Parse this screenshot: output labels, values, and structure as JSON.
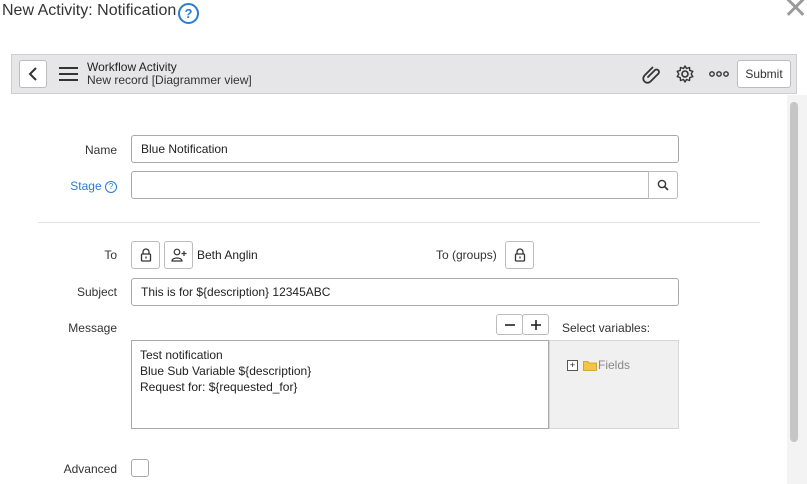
{
  "dialog": {
    "title": "New Activity: Notification",
    "help_glyph": "?",
    "close_glyph": "✕"
  },
  "header": {
    "title": "Workflow Activity",
    "subtitle": "New record [Diagrammer view]",
    "submit_label": "Submit",
    "icons": [
      "back-icon",
      "hamburger-menu-icon",
      "paperclip-icon",
      "gear-icon",
      "more-options-icon"
    ]
  },
  "form": {
    "name": {
      "label": "Name",
      "value": "Blue Notification"
    },
    "stage": {
      "label": "Stage",
      "value": "",
      "label_color": "#2a7bd4"
    },
    "to": {
      "label": "To",
      "value": "Beth Anglin"
    },
    "to_groups": {
      "label": "To (groups)"
    },
    "subject": {
      "label": "Subject",
      "value": "This is for ${description} 12345ABC"
    },
    "message": {
      "label": "Message",
      "lines": [
        "Test notification",
        "Blue Sub Variable ${description}",
        "Request for: ${requested_for}"
      ]
    },
    "select_variables": {
      "label": "Select variables:",
      "tree_item": "Fields"
    },
    "advanced": {
      "label": "Advanced",
      "checked": false
    }
  }
}
